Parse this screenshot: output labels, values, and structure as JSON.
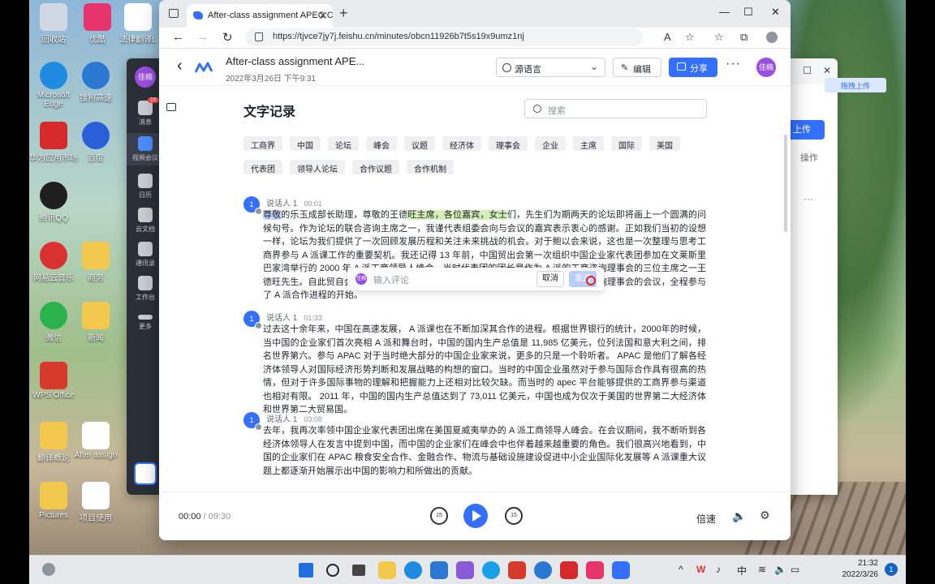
{
  "desktop": {
    "icons": [
      {
        "label": "回收站",
        "color": "#cfd8e3"
      },
      {
        "label": "优酷",
        "color": "#e8346c"
      },
      {
        "label": "法律翻译L",
        "color": "#ffffff"
      },
      {
        "label": "Microsoft Edge",
        "color": "#1f8be0"
      },
      {
        "label": "搜狗高速",
        "color": "#2a78d1"
      },
      {
        "label": "华为应用市场",
        "color": "#d62a2a"
      },
      {
        "label": "百度",
        "color": "#2b5fd9"
      },
      {
        "label": "腾讯QQ",
        "color": "#1f1f1f"
      },
      {
        "label": "网易云音乐",
        "color": "#d93030"
      },
      {
        "label": "商务",
        "color": "#f2c94c"
      },
      {
        "label": "微信",
        "color": "#2bb24c"
      },
      {
        "label": "新闻",
        "color": "#f2c94c"
      },
      {
        "label": "WPS Office",
        "color": "#d63a2b"
      },
      {
        "label": "翻译概论",
        "color": "#f2c94c"
      },
      {
        "label": "After assign",
        "color": "#ffffff"
      },
      {
        "label": "Pictures",
        "color": "#f2c94c"
      },
      {
        "label": "项目使用",
        "color": "#ffffff"
      }
    ]
  },
  "bg_window": {
    "rail": [
      {
        "label": "消息",
        "badge": "16"
      },
      {
        "label": "视频会议"
      },
      {
        "label": "日历"
      },
      {
        "label": "云文档"
      },
      {
        "label": "通讯录"
      },
      {
        "label": "工作台"
      },
      {
        "label": "更多"
      }
    ],
    "user_avatar": "佳楠",
    "upload_label": "上传",
    "drag_upload_label": "拖拽上传",
    "ops_label": "操作",
    "ellipsis": "···"
  },
  "browser": {
    "tab_title": "After-class assignment APEC CEO",
    "url": "https://tjvce7jy7j.feishu.cn/minutes/obcn11926b7t5s19x9umz1nj",
    "window_controls": [
      "—",
      "☐",
      "✕"
    ]
  },
  "header": {
    "title": "After-class assignment APE...",
    "date": "2022年3月26日 下午9:31",
    "language_label": "源语言",
    "edit_label": "编辑",
    "share_label": "分享",
    "more_label": "···",
    "avatar": "佳楠"
  },
  "transcript": {
    "section_title": "文字记录",
    "search_placeholder": "搜索",
    "keywords": [
      "工商界",
      "中国",
      "论坛",
      "峰会",
      "议题",
      "经济体",
      "理事会",
      "企业",
      "主席",
      "国际",
      "美国",
      "代表团",
      "领导人论坛",
      "合作议题",
      "合作机制"
    ],
    "paragraphs": [
      {
        "speaker": "说话人 1",
        "time": "00:01",
        "selected": "尊敬",
        "mid1": "的乐玉成部长助理，尊敬的王德",
        "highlight": "旺主席，各位嘉宾，女士",
        "rest": "们，先生们为期两天的论坛即将画上一个圆满的问候句号。作为论坛的联合咨询主席之一，我谨代表组委会向与会议的嘉宾表示衷心的感谢。正如我们当初的设想一样，论坛为我们提供了一次回顾发展历程和关注未来挑战的机会。对于鲍以会来说，这也是一次整理与思考工商界参与 A 派课工作的重要契机。我还记得 13 年前，中国贸出会第一次组织中国企业家代表团参加在文莱斯里巴家湾举行的 2000 年 A 派工商领导人峰会，当时代表团的团长是作为 A 派的工商咨询理事会的三位主席之一王德旺先生。自此贸自会连续组织中国企业家代表团参加 A 派工商领导人峰会和工商咨询理事会的会议，全程参与了 A 派合作进程的开始。"
      },
      {
        "speaker": "说话人 1",
        "time": "01:33",
        "text": "过去这十余年来，中国在高速发展， A 派课也在不断加深其合作的进程。根据世界银行的统计，2000年的时候，当中国的企业家们首次亮相 A 派和舞台时，中国的国内生产总值是 11,985 亿美元，位列法国和意大利之间，排名世界第六。参与 APAC 对于当时绝大部分的中国企业家来说，更多的只是一个聆听者。 APAC 是他们了解各经济体领导人对国际经济形势判断和发展战略的构想的窗口。当时的中国企业虽然对于参与国际合作具有很高的热情，但对于许多国际事物的理解和把握能力上还相对比较欠缺。而当时的 apec 平台能够提供的工商界参与渠道也相对有限。 2011 年，中国的国内生产总值达到了 73,011 亿美元，中国也成为仅次于美国的世界第二大经济体和世界第二大贸易国。"
      },
      {
        "speaker": "说话人 1",
        "time": "03:08",
        "text": "去年，我再次率领中国企业家代表团出席在美国夏威夷举办的 A 派工商领导人峰会。在会议期间，我不断听到各经济体领导人在发言中提到中国，而中国的企业家们在峰会中也伴着越来越重要的角色。我们很高兴地看到，中国的企业家们在 APAC 粮食安全合作、金融合作、物流与基础设施建设促进中小企业国际化发展等 A 派课重大议题上都逐渐开始展示出中国的影响力和所做出的贡献。"
      }
    ]
  },
  "comment_popup": {
    "avatar": "佳楠",
    "placeholder": "输入评论",
    "cancel_label": "取消",
    "send_label": "发送"
  },
  "player": {
    "current_time": "00:00",
    "total_time": "/ 09:30",
    "rewind_label": "15",
    "forward_label": "15",
    "speed_label": "倍速"
  },
  "taskbar": {
    "time": "21:32",
    "date": "2022/3/26",
    "ime": "中",
    "notifications": "1"
  }
}
